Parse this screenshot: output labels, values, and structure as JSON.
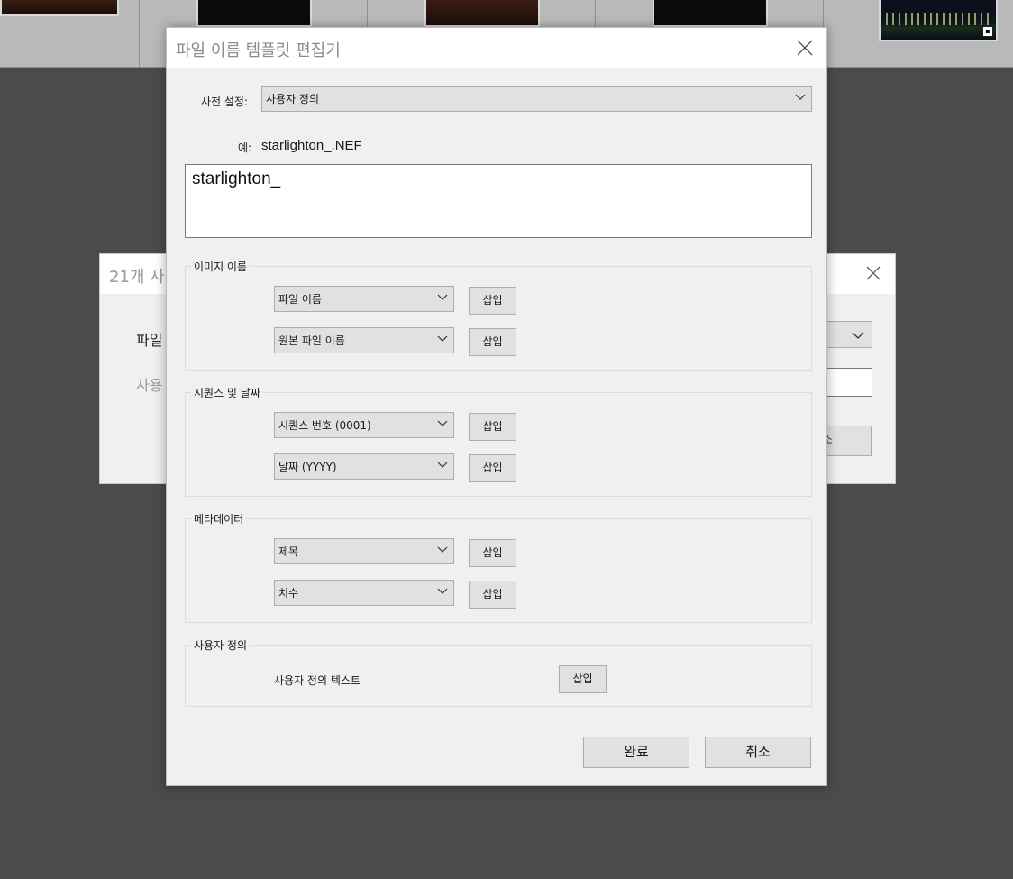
{
  "background": {
    "dialog_title": "21개 사",
    "field_label_1": "파일",
    "field_label_2": "사용",
    "button_partial": "소"
  },
  "editor": {
    "title": "파일 이름 템플릿 편집기",
    "preset_label": "사전 설정:",
    "preset_value": "사용자 정의",
    "example_label": "예:",
    "example_value": "starlighton_.NEF",
    "template_text": "starlighton_",
    "insert_label": "삽입",
    "groups": {
      "image_name": {
        "title": "이미지 이름",
        "select_1": "파일 이름",
        "select_2": "원본 파일 이름"
      },
      "sequence_date": {
        "title": "시퀀스 및 날짜",
        "select_1": "시퀀스 번호 (0001)",
        "select_2": "날짜 (YYYY)"
      },
      "metadata": {
        "title": "메타데이터",
        "select_1": "제목",
        "select_2": "치수"
      },
      "custom": {
        "title": "사용자 정의",
        "text_label": "사용자 정의 텍스트"
      }
    },
    "done_label": "완료",
    "cancel_label": "취소"
  },
  "colors": {
    "backdrop": "#4b4b4b",
    "dialog_bg": "#f0f0f0",
    "button_bg": "#e1e1e1",
    "title_text": "#8c8c8c"
  }
}
